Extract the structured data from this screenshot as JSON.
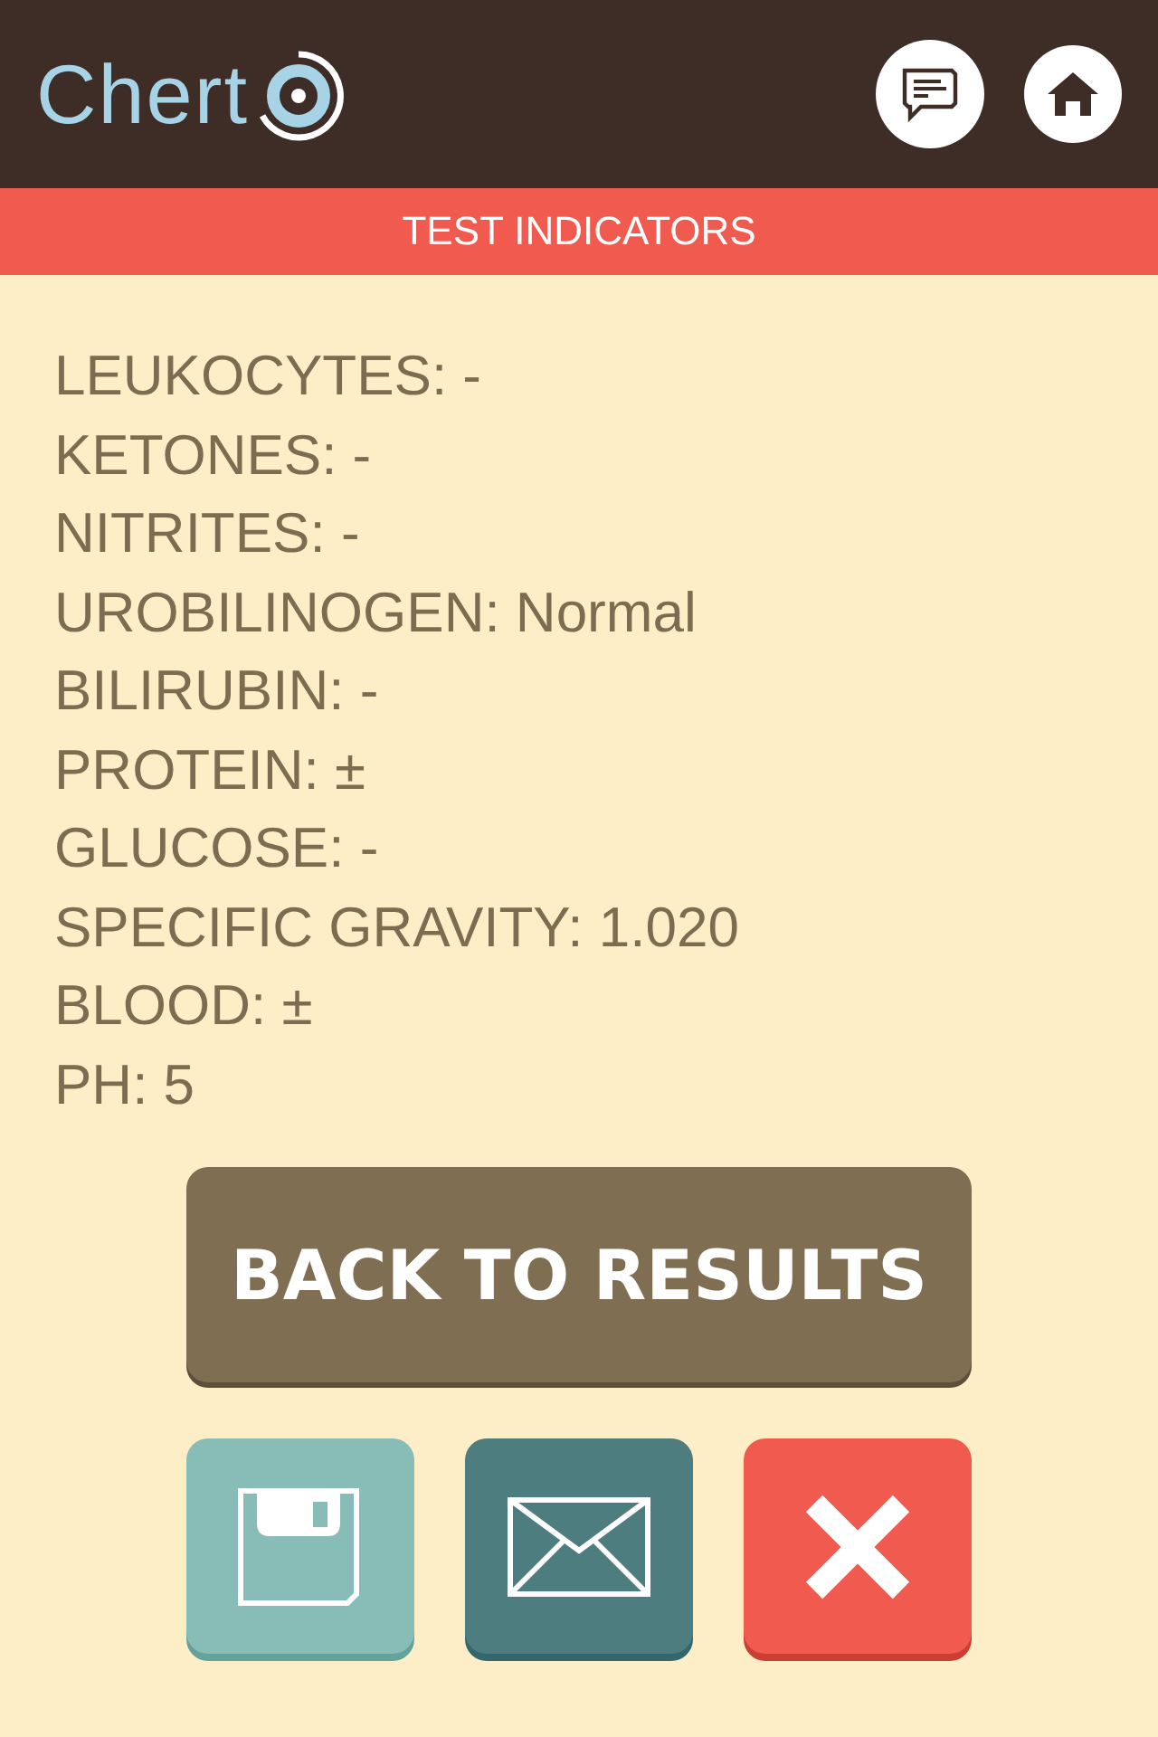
{
  "header": {
    "logo": "Chert"
  },
  "banner": {
    "title": "TEST INDICATORS"
  },
  "indicators": [
    "LEUKOCYTES: -",
    "KETONES: -",
    "NITRITES: -",
    "UROBILINOGEN: Normal",
    "BILIRUBIN: -",
    "PROTEIN: ±",
    "GLUCOSE: -",
    "SPECIFIC GRAVITY: 1.020",
    "BLOOD: ±",
    "PH: 5"
  ],
  "back_button": {
    "label": "BACK TO RESULTS"
  },
  "actions": [
    {
      "kind": "save"
    },
    {
      "kind": "email"
    },
    {
      "kind": "close"
    }
  ]
}
